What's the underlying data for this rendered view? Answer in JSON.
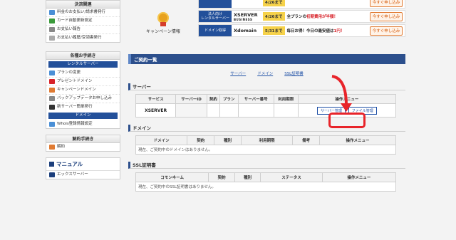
{
  "sidebar": {
    "payment": {
      "title": "決済関連",
      "items": [
        {
          "label": "料金のお支払い/請求書発行",
          "color": "#4a8fd6"
        },
        {
          "label": "カード自動更新設定",
          "color": "#3a9a3a"
        },
        {
          "label": "お支払い報告",
          "color": "#888888"
        },
        {
          "label": "お支払い履歴/受領書発行",
          "color": "#aaaaaa"
        }
      ]
    },
    "procedures": {
      "title": "各種お手続き",
      "rental_head": "レンタルサーバー",
      "rental_items": [
        {
          "label": "プランの変更",
          "color": "#4a8fd6"
        },
        {
          "label": "プレゼントドメイン",
          "color": "#d8232a"
        },
        {
          "label": "キャンペーンドメイン",
          "color": "#e07b33"
        },
        {
          "label": "バックアップデータお申し込み",
          "color": "#888888"
        },
        {
          "label": "新サーバー簡単移行",
          "color": "#333333"
        }
      ],
      "domain_head": "ドメイン",
      "domain_items": [
        {
          "label": "Whois登録情報設定",
          "color": "#4a8fd6"
        }
      ]
    },
    "cancel": {
      "title": "解約手続き",
      "items": [
        {
          "label": "解約",
          "color": "#e07b33"
        }
      ]
    },
    "manual": {
      "title": "マニュアル",
      "items": [
        {
          "label": "エックスサーバー",
          "color": "#1c3f7c"
        }
      ]
    }
  },
  "campaign": {
    "label": "キャンペーン情報",
    "rows": [
      {
        "tag": "",
        "brand": "",
        "brand_sub": "",
        "date": "4/26まで",
        "promo": "",
        "promo_red": "",
        "apply": "今すぐ申し込み"
      },
      {
        "tag": "法人向け\nレンタルサーバー",
        "brand": "XSERVER",
        "brand_sub": "BUSINESS",
        "date": "4/26まで",
        "promo": "全プランの",
        "promo_red": "初期費用が半額！",
        "apply": "今すぐ申し込み"
      },
      {
        "tag": "ドメイン取得",
        "brand": "Xdomain",
        "brand_sub": "",
        "date": "5/31まで",
        "promo": "毎日お得！今日の最安値は",
        "promo_red": "1円！",
        "apply": "今すぐ申し込み"
      }
    ]
  },
  "contracts": {
    "title": "ご契約一覧",
    "nav": [
      "サーバー",
      "ドメイン",
      "SSL証明書"
    ]
  },
  "server": {
    "title": "サーバー",
    "headers": [
      "サービス",
      "サーバーID",
      "契約",
      "プラン",
      "サーバー番号",
      "利用期限",
      "操作メニュー"
    ],
    "row": {
      "service": "XSERVER",
      "btn_manage": "サーバー管理",
      "btn_files": "ファイル管理"
    }
  },
  "domain": {
    "title": "ドメイン",
    "headers": [
      "ドメイン",
      "契約",
      "種別",
      "利用期限",
      "備考",
      "操作メニュー"
    ],
    "empty": "現在、ご契約中のドメインはありません。"
  },
  "ssl": {
    "title": "SSL証明書",
    "headers": [
      "コモンネーム",
      "契約",
      "種別",
      "ステータス",
      "操作メニュー"
    ],
    "empty": "現在、ご契約中のSSL証明書はありません。"
  },
  "colors": {
    "accent": "#2c4f8c",
    "highlight": "#e8242a"
  }
}
